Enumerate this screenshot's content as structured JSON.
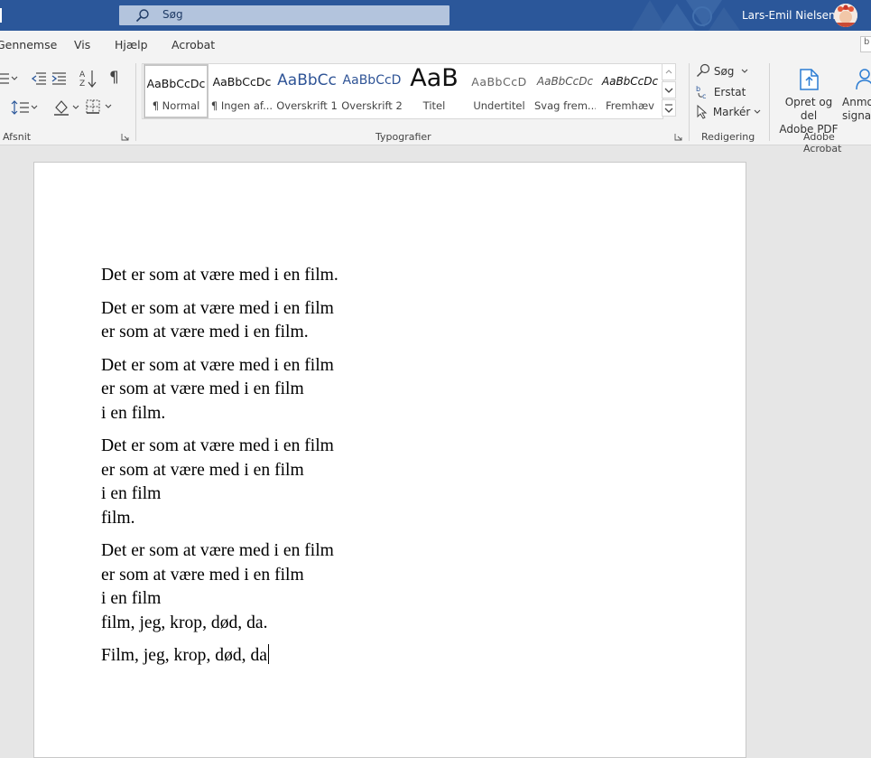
{
  "titlebar": {
    "search_placeholder": "Søg",
    "user_name": "Lars-Emil Nielsen",
    "accent": "#2b579a"
  },
  "tabs": [
    {
      "label": "Gennemse"
    },
    {
      "label": "Vis"
    },
    {
      "label": "Hjælp"
    },
    {
      "label": "Acrobat"
    }
  ],
  "tabs_right_box": "b",
  "ribbon": {
    "groups": {
      "afsnit": "Afsnit",
      "typografier": "Typografier",
      "redigering": "Redigering",
      "adobe_acrobat": "Adobe Acrobat"
    },
    "styles": [
      {
        "preview": "AaBbCcDc",
        "name": "¶ Normal"
      },
      {
        "preview": "AaBbCcDc",
        "name": "¶ Ingen af..."
      },
      {
        "preview": "AaBbCc",
        "name": "Overskrift 1"
      },
      {
        "preview": "AaBbCcD",
        "name": "Overskrift 2"
      },
      {
        "preview": "AaB",
        "name": "Titel"
      },
      {
        "preview": "AaBbCcD",
        "name": "Undertitel"
      },
      {
        "preview": "AaBbCcDc",
        "name": "Svag frem..."
      },
      {
        "preview": "AaBbCcDc",
        "name": "Fremhæv"
      }
    ],
    "editing": {
      "find": "Søg",
      "replace": "Erstat",
      "select": "Markér"
    },
    "acrobat": {
      "create_pdf": [
        "Opret og del",
        "Adobe PDF"
      ],
      "request_sig": [
        "Anmo",
        "signa"
      ]
    }
  },
  "document": {
    "paragraphs": [
      [
        "Det er som at være med i en film."
      ],
      [
        "Det er som at være med i en film",
        "er som at være med i en film."
      ],
      [
        "Det er som at være med i en film",
        "er som at være med i en film",
        "i en film."
      ],
      [
        "Det er som at være med i en film",
        "er som at være med i en film",
        "i en film",
        "film."
      ],
      [
        "Det er som at være med i en film",
        "er som at være med i en film",
        "i en film",
        "film, jeg, krop, død, da."
      ],
      [
        "Film, jeg, krop, død, da"
      ]
    ]
  }
}
